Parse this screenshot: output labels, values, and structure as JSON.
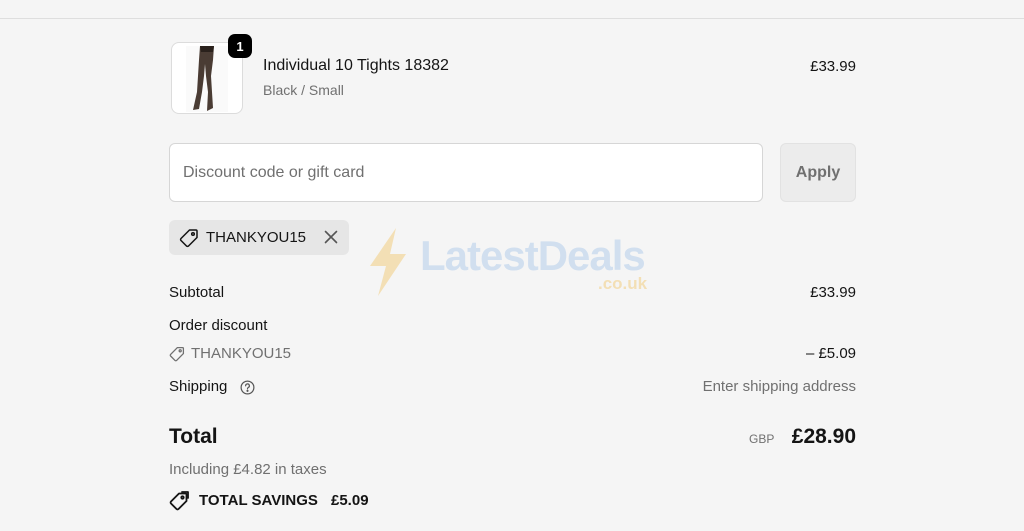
{
  "product": {
    "name": "Individual 10 Tights 18382",
    "variant": "Black / Small",
    "price": "£33.99",
    "quantity": "1"
  },
  "discount": {
    "placeholder": "Discount code or gift card",
    "value": "",
    "apply_label": "Apply",
    "applied_code": "THANKYOU15"
  },
  "summary": {
    "subtotal_label": "Subtotal",
    "subtotal_value": "£33.99",
    "order_discount_label": "Order discount",
    "discount_code": "THANKYOU15",
    "discount_value": "– £5.09",
    "shipping_label": "Shipping",
    "shipping_value": "Enter shipping address",
    "total_label": "Total",
    "currency": "GBP",
    "total_value": "£28.90",
    "tax_note": "Including £4.82 in taxes",
    "savings_label": "TOTAL SAVINGS",
    "savings_value": "£5.09"
  },
  "watermark": {
    "brand": "LatestDeals",
    "domain": ".co.uk"
  },
  "icons": {
    "tag": "tag-icon",
    "close": "close-icon",
    "help": "help-icon",
    "savings": "savings-tag-icon"
  }
}
